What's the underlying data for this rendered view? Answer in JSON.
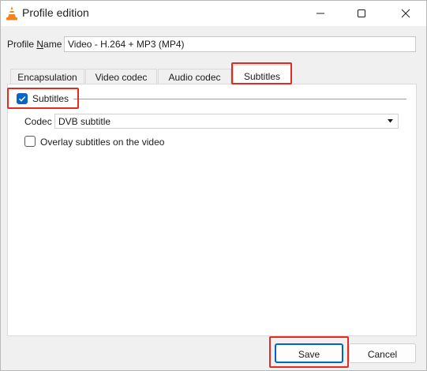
{
  "window": {
    "title": "Profile edition",
    "icon": "vlc-cone-icon",
    "controls": [
      "minimize-icon",
      "maximize-icon",
      "close-icon"
    ]
  },
  "profile": {
    "label_prefix": "Profile ",
    "label_mnemonic": "N",
    "label_suffix": "ame",
    "value": "Video - H.264 + MP3 (MP4)"
  },
  "tabs": [
    {
      "label": "Encapsulation",
      "selected": false
    },
    {
      "label": "Video codec",
      "selected": false
    },
    {
      "label": "Audio codec",
      "selected": false
    },
    {
      "label": "Subtitles",
      "selected": true
    }
  ],
  "subtitles": {
    "enable_label": "Subtitles",
    "enabled": true,
    "codec_label": "Codec",
    "codec_value": "DVB subtitle",
    "overlay_label": "Overlay subtitles on the video",
    "overlay_checked": false
  },
  "buttons": {
    "save": "Save",
    "cancel": "Cancel"
  },
  "colors": {
    "highlight": "#e32b1f",
    "accent": "#0a64c8",
    "default_button_border": "#0067c0"
  }
}
